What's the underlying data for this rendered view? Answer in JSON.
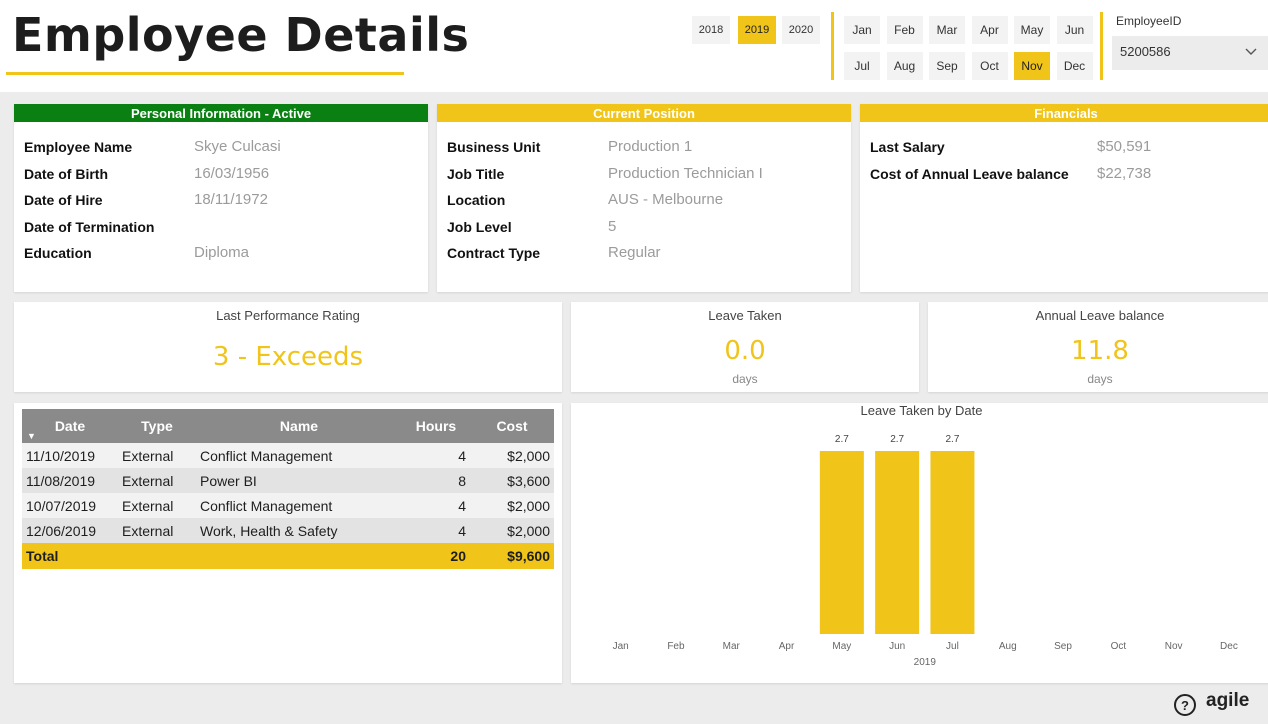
{
  "page": {
    "title": "Employee Details"
  },
  "filters": {
    "years": [
      {
        "label": "2018",
        "selected": false
      },
      {
        "label": "2019",
        "selected": true
      },
      {
        "label": "2020",
        "selected": false
      }
    ],
    "months": [
      {
        "label": "Jan",
        "selected": false
      },
      {
        "label": "Feb",
        "selected": false
      },
      {
        "label": "Mar",
        "selected": false
      },
      {
        "label": "Apr",
        "selected": false
      },
      {
        "label": "May",
        "selected": false
      },
      {
        "label": "Jun",
        "selected": false
      },
      {
        "label": "Jul",
        "selected": false
      },
      {
        "label": "Aug",
        "selected": false
      },
      {
        "label": "Sep",
        "selected": false
      },
      {
        "label": "Oct",
        "selected": false
      },
      {
        "label": "Nov",
        "selected": true
      },
      {
        "label": "Dec",
        "selected": false
      }
    ],
    "employee": {
      "label": "EmployeeID",
      "value": "5200586",
      "icon": "chevron-down-icon"
    }
  },
  "personal": {
    "header": "Personal Information - Active",
    "header_color": "#0a8012",
    "rows": [
      {
        "key": "Employee Name",
        "value": "Skye Culcasi"
      },
      {
        "key": "Date of Birth",
        "value": "16/03/1956"
      },
      {
        "key": "Date of Hire",
        "value": "18/11/1972"
      },
      {
        "key": "Date of Termination",
        "value": ""
      },
      {
        "key": "Education",
        "value": "Diploma"
      }
    ]
  },
  "position": {
    "header": "Current Position",
    "rows": [
      {
        "key": "Business Unit",
        "value": "Production 1"
      },
      {
        "key": "Job Title",
        "value": "Production Technician I"
      },
      {
        "key": "Location",
        "value": "AUS - Melbourne"
      },
      {
        "key": "Job Level",
        "value": "5"
      },
      {
        "key": "Contract Type",
        "value": "Regular"
      }
    ]
  },
  "financials": {
    "header": "Financials",
    "rows": [
      {
        "key": "Last Salary",
        "value": "$50,591"
      },
      {
        "key": "Cost of Annual Leave balance",
        "value": "$22,738"
      }
    ]
  },
  "kpis": {
    "performance": {
      "title": "Last Performance Rating",
      "value": "3 - Exceeds"
    },
    "leave_taken": {
      "title": "Leave Taken",
      "value": "0.0",
      "unit": "days"
    },
    "leave_balance": {
      "title": "Annual Leave balance",
      "value": "11.8",
      "unit": "days"
    }
  },
  "training_table": {
    "columns": [
      "Date",
      "Type",
      "Name",
      "Hours",
      "Cost"
    ],
    "rows": [
      [
        "11/10/2019",
        "External",
        "Conflict Management",
        "4",
        "$2,000"
      ],
      [
        "11/08/2019",
        "External",
        "Power BI",
        "8",
        "$3,600"
      ],
      [
        "10/07/2019",
        "External",
        "Conflict Management",
        "4",
        "$2,000"
      ],
      [
        "12/06/2019",
        "External",
        "Work, Health & Safety",
        "4",
        "$2,000"
      ]
    ],
    "total": [
      "Total",
      "",
      "",
      "20",
      "$9,600"
    ],
    "sort_icon": "sort-down-icon"
  },
  "colors": {
    "accent": "#f0c419",
    "green": "#0a8012"
  },
  "chart_data": {
    "type": "bar",
    "title": "Leave Taken by Date",
    "categories": [
      "Jan",
      "Feb",
      "Mar",
      "Apr",
      "May",
      "Jun",
      "Jul",
      "Aug",
      "Sep",
      "Oct",
      "Nov",
      "Dec"
    ],
    "values": [
      0,
      0,
      0,
      0,
      2.7,
      2.7,
      2.7,
      0,
      0,
      0,
      0,
      0
    ],
    "data_labels": [
      "",
      "",
      "",
      "",
      "2.7",
      "2.7",
      "2.7",
      "",
      "",
      "",
      "",
      ""
    ],
    "xlabel": "2019",
    "ylim": [
      0,
      2.7
    ],
    "color": "#f0c419",
    "grid": false
  },
  "footer": {
    "help_icon": "help-icon",
    "help_symbol": "?",
    "logo_text": "agile"
  }
}
